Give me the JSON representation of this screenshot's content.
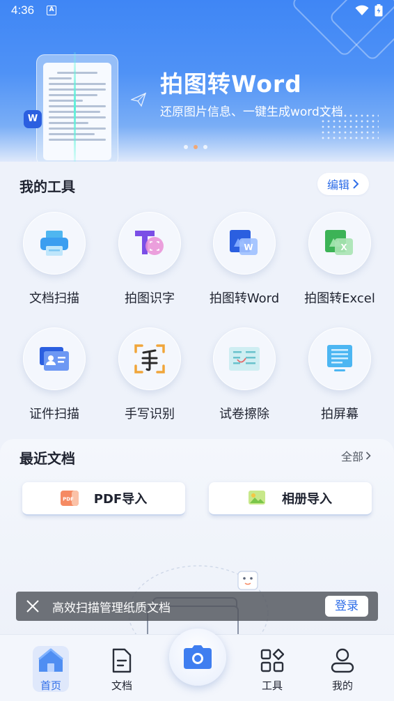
{
  "status_bar": {
    "time": "4:36",
    "notif_letter": "A"
  },
  "banner": {
    "title": "拍图转Word",
    "subtitle": "还原图片信息、一键生成word文档",
    "badge": "W",
    "page_count": 3,
    "active_page": 1
  },
  "tools_section": {
    "title": "我的工具",
    "edit_label": "编辑",
    "items": [
      {
        "label": "文档扫描",
        "icon": "printer-icon"
      },
      {
        "label": "拍图识字",
        "icon": "text-recognition-icon"
      },
      {
        "label": "拍图转Word",
        "icon": "word-icon"
      },
      {
        "label": "拍图转Excel",
        "icon": "excel-icon"
      },
      {
        "label": "证件扫描",
        "icon": "id-card-icon"
      },
      {
        "label": "手写识别",
        "icon": "handwriting-icon"
      },
      {
        "label": "试卷擦除",
        "icon": "paper-erase-icon"
      },
      {
        "label": "拍屏幕",
        "icon": "screen-icon"
      }
    ]
  },
  "recent_section": {
    "title": "最近文档",
    "all_label": "全部",
    "pdf_import": {
      "label": "PDF导入",
      "icon_text": "PDF"
    },
    "album_import": {
      "label": "相册导入"
    }
  },
  "toast": {
    "message": "高效扫描管理纸质文档",
    "login_label": "登录"
  },
  "bottom_nav": {
    "home": "首页",
    "docs": "文档",
    "tools": "工具",
    "mine": "我的"
  },
  "colors": {
    "accent": "#2f6ee8",
    "banner_top": "#3f86f5",
    "page_bg": "#eef2fa"
  }
}
